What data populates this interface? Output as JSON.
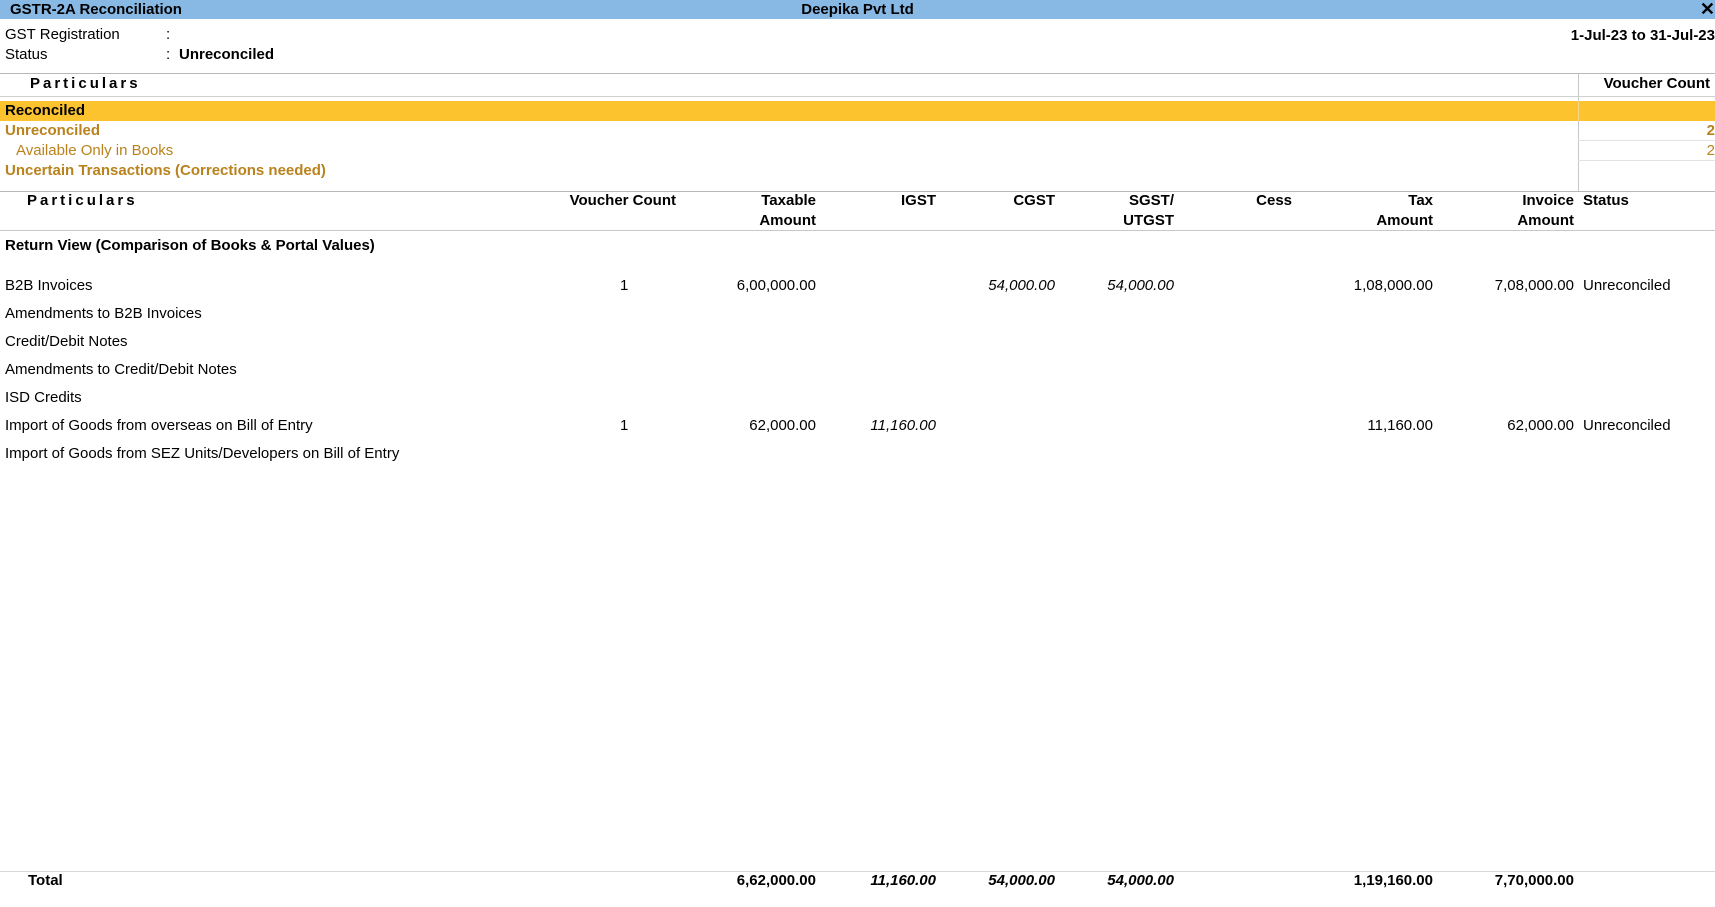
{
  "window": {
    "title": "GSTR-2A Reconciliation",
    "company": "Deepika Pvt Ltd",
    "close_glyph": "✕"
  },
  "info": {
    "gst_registration_label": "GST Registration",
    "gst_registration_colon": ":",
    "status_label": "Status",
    "status_colon": ":",
    "status_value": "Unreconciled",
    "period": "1-Jul-23 to 31-Jul-23"
  },
  "summary": {
    "particulars_header": "Particulars",
    "voucher_count_header": "Voucher Count",
    "rows": [
      {
        "label": "Reconciled",
        "count": ""
      },
      {
        "label": "Unreconciled",
        "count": "2"
      },
      {
        "label": "Available Only in Books",
        "count": "2"
      },
      {
        "label": "Uncertain Transactions (Corrections needed)",
        "count": ""
      }
    ]
  },
  "table": {
    "headers": {
      "particulars": "Particulars",
      "voucher_count": "Voucher Count",
      "taxable_1": "Taxable",
      "taxable_2": "Amount",
      "igst": "IGST",
      "cgst": "CGST",
      "sgst_1": "SGST/",
      "sgst_2": "UTGST",
      "cess": "Cess",
      "tax_1": "Tax",
      "tax_2": "Amount",
      "invoice_1": "Invoice",
      "invoice_2": "Amount",
      "status": "Status"
    },
    "section_title": "Return View (Comparison of Books & Portal Values)",
    "rows": [
      {
        "particulars": "B2B Invoices",
        "voucher_count": "1",
        "taxable": "6,00,000.00",
        "igst": "",
        "cgst": "54,000.00",
        "sgst": "54,000.00",
        "cess": "",
        "tax": "1,08,000.00",
        "invoice": "7,08,000.00",
        "status": "Unreconciled"
      },
      {
        "particulars": "Amendments to B2B Invoices",
        "voucher_count": "",
        "taxable": "",
        "igst": "",
        "cgst": "",
        "sgst": "",
        "cess": "",
        "tax": "",
        "invoice": "",
        "status": ""
      },
      {
        "particulars": "Credit/Debit Notes",
        "voucher_count": "",
        "taxable": "",
        "igst": "",
        "cgst": "",
        "sgst": "",
        "cess": "",
        "tax": "",
        "invoice": "",
        "status": ""
      },
      {
        "particulars": "Amendments to Credit/Debit Notes",
        "voucher_count": "",
        "taxable": "",
        "igst": "",
        "cgst": "",
        "sgst": "",
        "cess": "",
        "tax": "",
        "invoice": "",
        "status": ""
      },
      {
        "particulars": "ISD Credits",
        "voucher_count": "",
        "taxable": "",
        "igst": "",
        "cgst": "",
        "sgst": "",
        "cess": "",
        "tax": "",
        "invoice": "",
        "status": ""
      },
      {
        "particulars": "Import of Goods from overseas on Bill of Entry",
        "voucher_count": "1",
        "taxable": "62,000.00",
        "igst": "11,160.00",
        "cgst": "",
        "sgst": "",
        "cess": "",
        "tax": "11,160.00",
        "invoice": "62,000.00",
        "status": "Unreconciled"
      },
      {
        "particulars": "Import of Goods from SEZ Units/Developers on Bill of Entry",
        "voucher_count": "",
        "taxable": "",
        "igst": "",
        "cgst": "",
        "sgst": "",
        "cess": "",
        "tax": "",
        "invoice": "",
        "status": ""
      }
    ],
    "total": {
      "label": "Total",
      "taxable": "6,62,000.00",
      "igst": "11,160.00",
      "cgst": "54,000.00",
      "sgst": "54,000.00",
      "tax": "1,19,160.00",
      "invoice": "7,70,000.00"
    }
  }
}
